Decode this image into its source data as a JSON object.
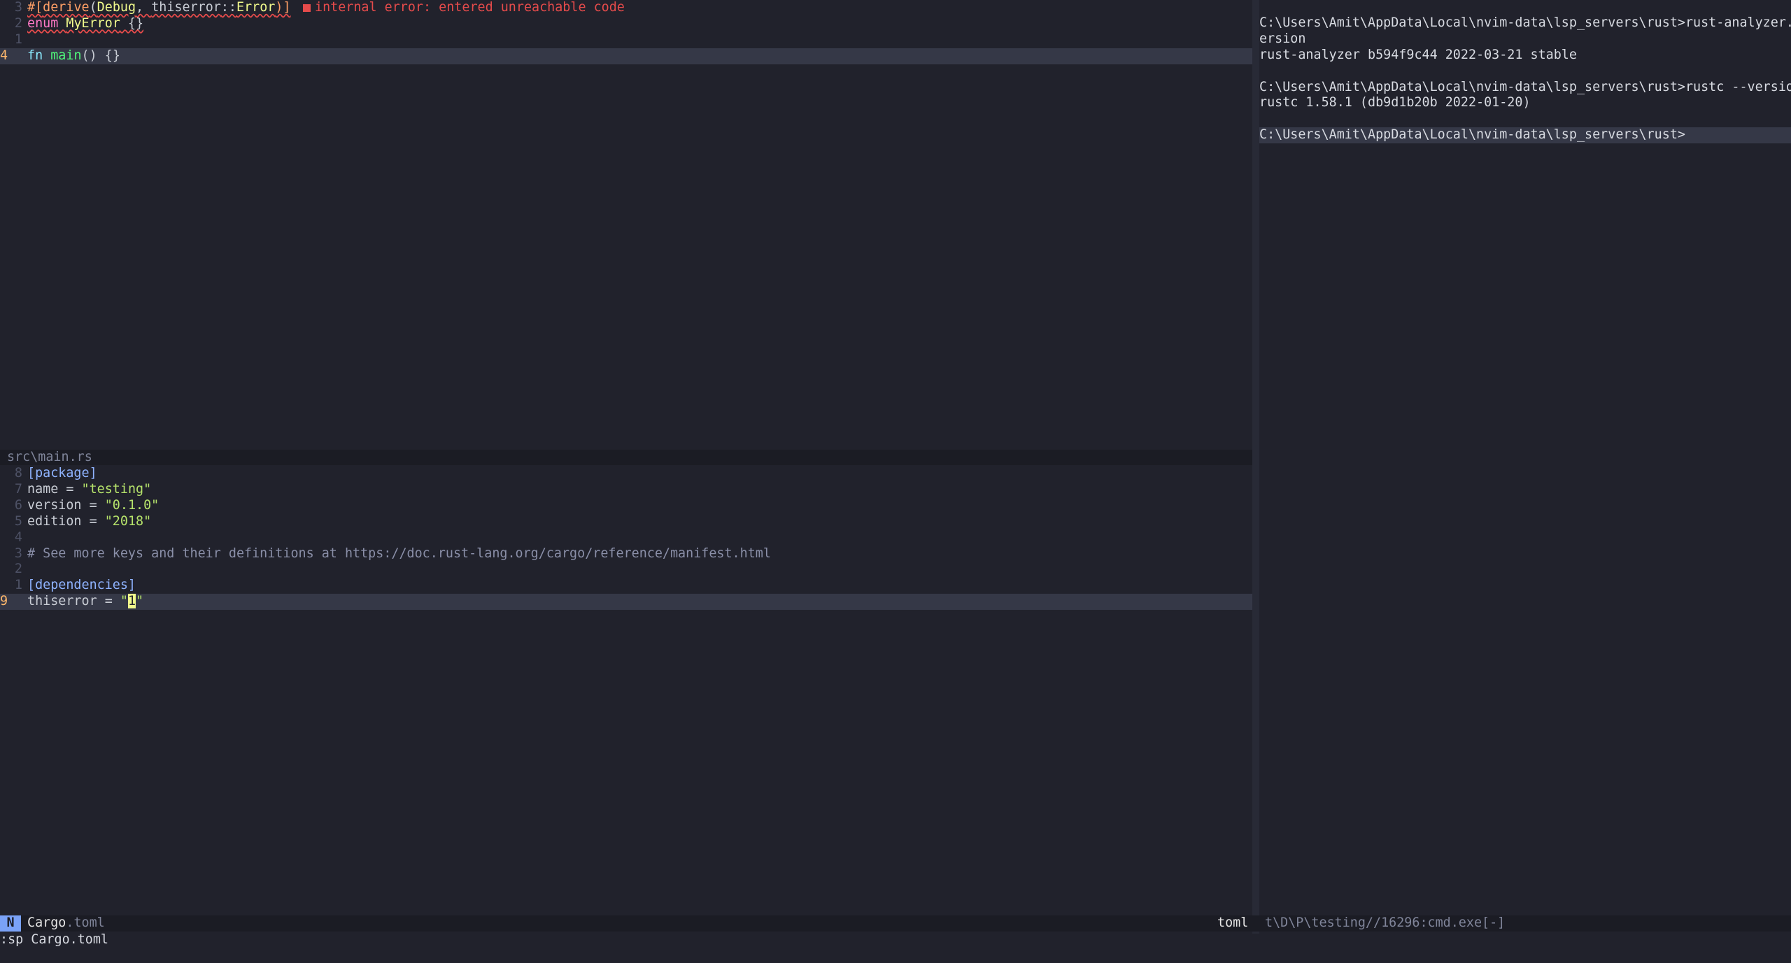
{
  "top_buffer": {
    "lines": [
      {
        "num": "3",
        "parts": [
          {
            "t": "#[",
            "c": "attr err-ul"
          },
          {
            "t": "derive",
            "c": "attr err-ul"
          },
          {
            "t": "(",
            "c": "err-ul"
          },
          {
            "t": "Debug",
            "c": "type err-ul"
          },
          {
            "t": ", ",
            "c": "err-ul"
          },
          {
            "t": "thiserror",
            "c": "err-ul"
          },
          {
            "t": "::",
            "c": "err-ul"
          },
          {
            "t": "Error",
            "c": "type err-ul"
          },
          {
            "t": ")]",
            "c": "attr err-ul"
          }
        ],
        "diagnostic": "internal error: entered unreachable code"
      },
      {
        "num": "2",
        "parts": [
          {
            "t": "enum",
            "c": "kw err-ul"
          },
          {
            "t": " ",
            "c": "err-ul"
          },
          {
            "t": "MyError",
            "c": "type err-ul"
          },
          {
            "t": " {}",
            "c": "err-ul"
          }
        ]
      },
      {
        "num": "1",
        "parts": []
      },
      {
        "num": "4",
        "current": true,
        "parts": [
          {
            "t": "fn",
            "c": "kw2"
          },
          {
            "t": " "
          },
          {
            "t": "main",
            "c": "fn"
          },
          {
            "t": "() {}"
          }
        ]
      }
    ],
    "winbar": "src\\main.rs"
  },
  "bottom_buffer": {
    "lines": [
      {
        "num": "8",
        "parts": [
          {
            "t": "[package]",
            "c": "hdr"
          }
        ]
      },
      {
        "num": "7",
        "parts": [
          {
            "t": "name = "
          },
          {
            "t": "\"testing\"",
            "c": "str"
          }
        ]
      },
      {
        "num": "6",
        "parts": [
          {
            "t": "version = "
          },
          {
            "t": "\"0.1.0\"",
            "c": "str"
          }
        ]
      },
      {
        "num": "5",
        "parts": [
          {
            "t": "edition = "
          },
          {
            "t": "\"2018\"",
            "c": "str"
          }
        ]
      },
      {
        "num": "4",
        "parts": []
      },
      {
        "num": "3",
        "parts": [
          {
            "t": "# See more keys and their definitions at https://doc.rust-lang.org/cargo/reference/manifest.html",
            "c": "cmt"
          }
        ]
      },
      {
        "num": "2",
        "parts": []
      },
      {
        "num": "1",
        "parts": [
          {
            "t": "[dependencies]",
            "c": "hdr"
          }
        ]
      },
      {
        "num": "9",
        "current": true,
        "parts": [
          {
            "t": "thiserror = "
          },
          {
            "t": "\"",
            "c": "str"
          },
          {
            "t": "1",
            "c": "cursor"
          },
          {
            "t": "\"",
            "c": "str"
          }
        ]
      }
    ]
  },
  "terminal": {
    "lines": [
      "C:\\Users\\Amit\\AppData\\Local\\nvim-data\\lsp_servers\\rust>rust-analyzer.exe --v",
      "ersion",
      "rust-analyzer b594f9c44 2022-03-21 stable",
      "",
      "C:\\Users\\Amit\\AppData\\Local\\nvim-data\\lsp_servers\\rust>rustc --version",
      "rustc 1.58.1 (db9d1b20b 2022-01-20)",
      "",
      "C:\\Users\\Amit\\AppData\\Local\\nvim-data\\lsp_servers\\rust>"
    ],
    "selected_line_index": 7
  },
  "statusline": {
    "mode": "N",
    "file_name": "Cargo",
    "file_ext": ".toml",
    "filetype": "toml",
    "terminal_status": "t\\D\\P\\testing//16296:cmd.exe[-]"
  },
  "cmdline": ":sp Cargo.toml"
}
